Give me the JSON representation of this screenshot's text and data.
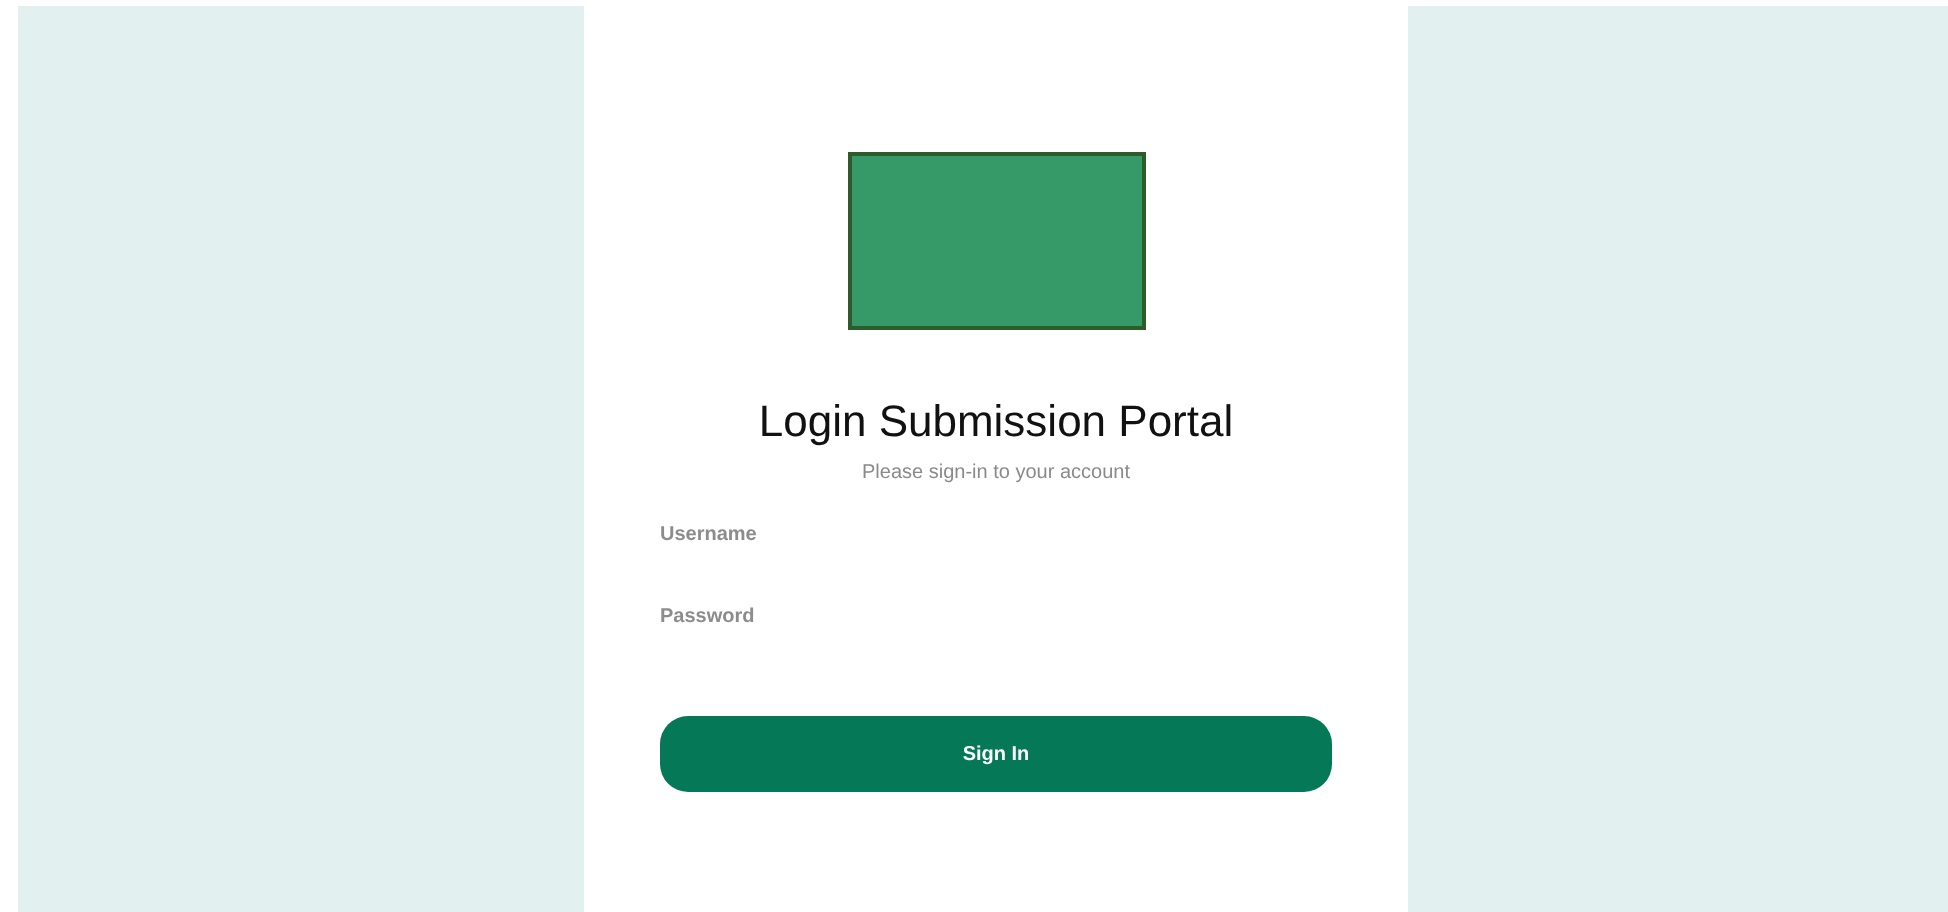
{
  "card": {
    "title": "Login Submission Portal",
    "subtitle": "Please sign-in to your account",
    "fields": [
      {
        "label": "Username"
      },
      {
        "label": "Password"
      }
    ],
    "button": "Sign In"
  }
}
